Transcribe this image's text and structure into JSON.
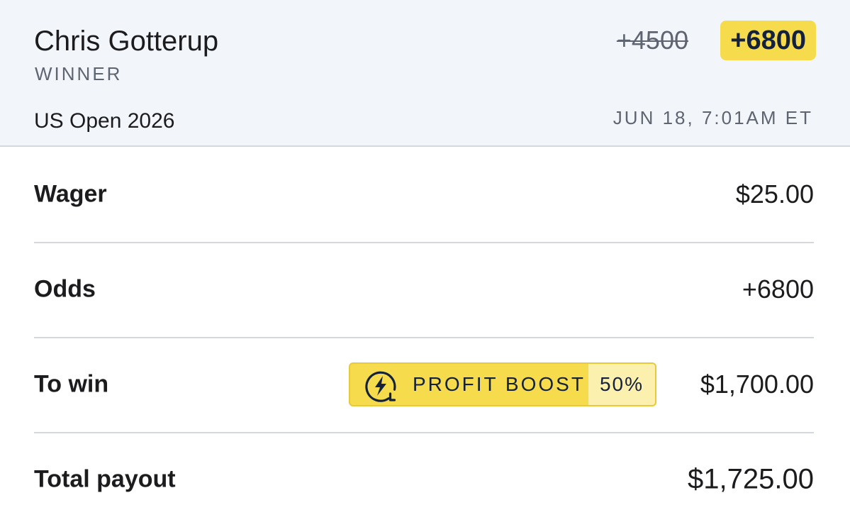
{
  "header": {
    "player": "Chris Gotterup",
    "market": "WINNER",
    "event": "US Open 2026",
    "datetime": "JUN 18, 7:01AM ET",
    "odds_original": "+4500",
    "odds_boosted": "+6800"
  },
  "rows": {
    "wager": {
      "label": "Wager",
      "value": "$25.00"
    },
    "odds": {
      "label": "Odds",
      "value": "+6800"
    },
    "to_win": {
      "label": "To win",
      "value": "$1,700.00",
      "boost": {
        "icon": "lightning-bolt-icon",
        "label": "PROFIT BOOST",
        "percent": "50%"
      }
    },
    "total_payout": {
      "label": "Total payout",
      "value": "$1,725.00"
    }
  },
  "colors": {
    "accent_yellow": "#f6dc4c",
    "accent_yellow_light": "#fbf0ad",
    "navy": "#14213d",
    "header_bg": "#f2f6fb",
    "divider": "#d4d8de"
  }
}
